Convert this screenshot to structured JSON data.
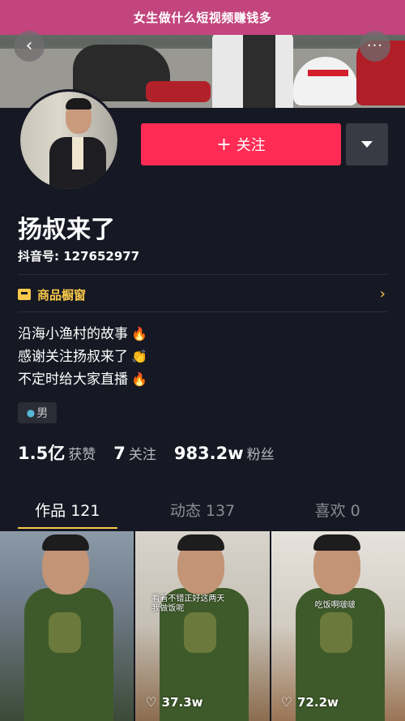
{
  "banner": {
    "title": "女生做什么短视频赚钱多"
  },
  "profile": {
    "name": "扬叔来了",
    "douyin_id": "抖音号: 127652977",
    "follow_label": "关注",
    "follow_plus": "+",
    "shop_label": "商品橱窗",
    "bio_lines": [
      {
        "text": "沿海小渔村的故事",
        "emoji": "🔥"
      },
      {
        "text": "感谢关注扬叔来了",
        "emoji": "👏"
      },
      {
        "text": "不定时给大家直播",
        "emoji": "🔥"
      }
    ],
    "gender": "男"
  },
  "stats": [
    {
      "num": "1.5亿",
      "label": "获赞"
    },
    {
      "num": "7",
      "label": "关注"
    },
    {
      "num": "983.2w",
      "label": "粉丝"
    }
  ],
  "tabs": [
    {
      "label": "作品 121",
      "active": true
    },
    {
      "label": "动态 137",
      "active": false
    },
    {
      "label": "喜欢 0",
      "active": false
    }
  ],
  "videos": [
    {
      "caption": "",
      "likes": ""
    },
    {
      "caption": "看着不错正好这两天\n我做饭呢",
      "likes": "37.3w"
    },
    {
      "caption": "吃饭啊啵啵",
      "likes": "72.2w"
    }
  ],
  "colors": {
    "background": "#161823",
    "accent": "#fe2c55",
    "gold": "#f7c84a",
    "banner": "#c2457d"
  },
  "icons": [
    "back-icon",
    "more-icon",
    "plus-icon",
    "dropdown-icon",
    "shop-icon",
    "chevron-right-icon",
    "gender-icon",
    "heart-icon"
  ]
}
